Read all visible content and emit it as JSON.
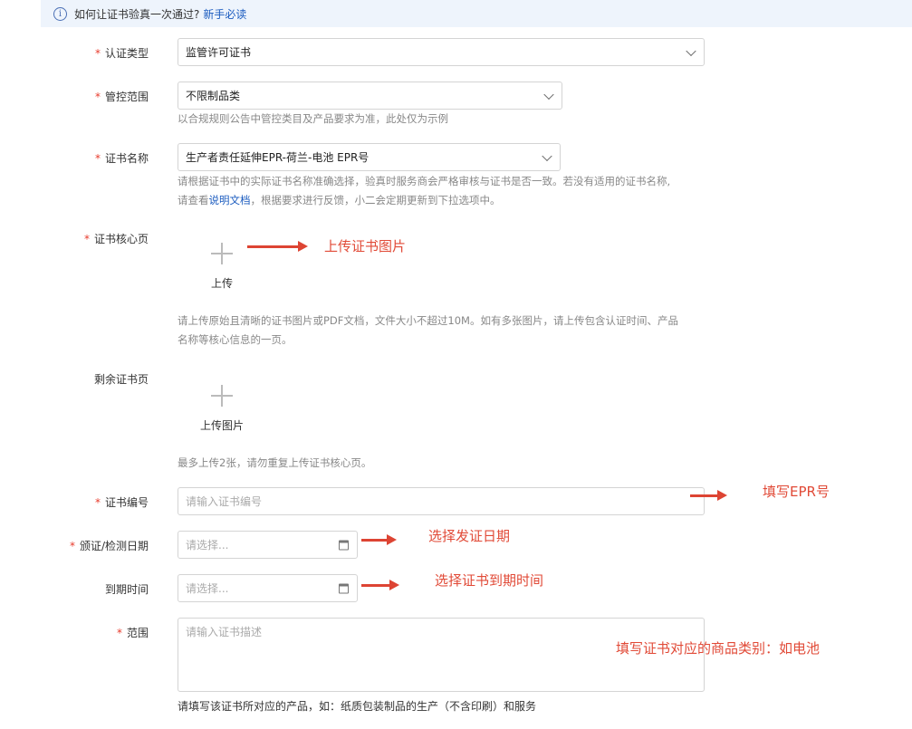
{
  "banner": {
    "text": "如何让证书验真一次通过?",
    "link": "新手必读"
  },
  "fields": {
    "cert_type": {
      "label": "认证类型",
      "value": "监管许可证书"
    },
    "control_scope": {
      "label": "管控范围",
      "value": "不限制品类",
      "hint": "以合规规则公告中管控类目及产品要求为准，此处仅为示例"
    },
    "cert_name": {
      "label": "证书名称",
      "value": "生产者责任延伸EPR-荷兰-电池 EPR号",
      "hint_line1": "请根据证书中的实际证书名称准确选择，验真时服务商会严格审核与证书是否一致。若没有适用的证书名称,",
      "hint_pre": "请查看",
      "hint_link": "说明文档",
      "hint_post": "，根据要求进行反馈，小二会定期更新到下拉选项中。"
    },
    "core_page": {
      "label": "证书核心页",
      "upload_label": "上传",
      "hint_line1": "请上传原始且清晰的证书图片或PDF文档，文件大小不超过10M。如有多张图片，请上传包含认证时间、产品",
      "hint_line2": "名称等核心信息的一页。"
    },
    "other_pages": {
      "label": "剩余证书页",
      "upload_label": "上传图片",
      "hint": "最多上传2张，请勿重复上传证书核心页。"
    },
    "cert_number": {
      "label": "证书编号",
      "placeholder": "请输入证书编号"
    },
    "issue_date": {
      "label": "颁证/检测日期",
      "placeholder": "请选择..."
    },
    "expire_date": {
      "label": "到期时间",
      "placeholder": "请选择..."
    },
    "scope": {
      "label": "范围",
      "placeholder": "请输入证书描述",
      "hint": "请填写该证书所对应的产品，如：纸质包装制品的生产（不含印刷）和服务"
    }
  },
  "required_mark": "*",
  "annotations": {
    "upload": "上传证书图片",
    "epr": "填写EPR号",
    "issue": "选择发证日期",
    "expire": "选择证书到期时间",
    "scope": "填写证书对应的商品类别：如电池"
  },
  "colors": {
    "required": "#e83b2c",
    "annotation": "#e14a37",
    "link": "#1a5bbf",
    "banner_bg": "#eef4fc"
  },
  "icons": {
    "banner": "info-icon",
    "select": "chevron-down-icon",
    "date": "calendar-icon",
    "upload": "plus-icon",
    "annotation": "arrow-right-icon"
  }
}
